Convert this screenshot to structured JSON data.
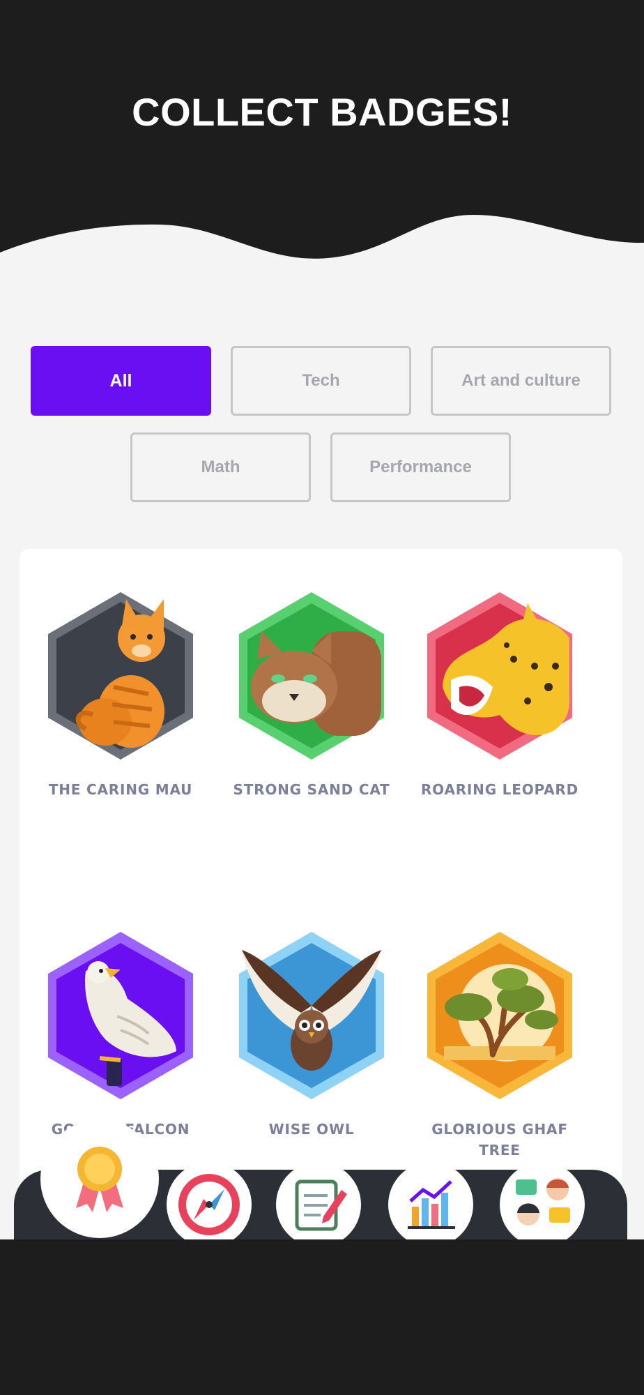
{
  "header": {
    "title": "COLLECT BADGES!"
  },
  "filters": [
    {
      "label": "All",
      "active": true
    },
    {
      "label": "Tech",
      "active": false
    },
    {
      "label": "Art and culture",
      "active": false
    },
    {
      "label": "Math",
      "active": false
    },
    {
      "label": "Performance",
      "active": false
    }
  ],
  "badges": [
    {
      "label": "THE CARING MAU",
      "icon": "cat-icon",
      "color": "#4b4f58"
    },
    {
      "label": "STRONG SAND CAT",
      "icon": "sand-cat-icon",
      "color": "#3fbf5a"
    },
    {
      "label": "ROARING LEOPARD",
      "icon": "leopard-icon",
      "color": "#e8415c"
    },
    {
      "label": "GOLDEN FALCON",
      "icon": "falcon-icon",
      "color": "#8a46ff"
    },
    {
      "label": "WISE OWL",
      "icon": "owl-icon",
      "color": "#5fb5ee"
    },
    {
      "label": "GLORIOUS GHAF TREE",
      "icon": "tree-icon",
      "color": "#f3a423"
    }
  ],
  "nav": [
    {
      "icon": "award-ribbon-icon",
      "active": true
    },
    {
      "icon": "compass-icon",
      "active": false
    },
    {
      "icon": "notepad-pencil-icon",
      "active": false
    },
    {
      "icon": "bar-chart-icon",
      "active": false
    },
    {
      "icon": "chat-people-icon",
      "active": false
    }
  ],
  "colors": {
    "accent": "#6a0ff1",
    "header_bg": "#1d1d1e",
    "nav_bg": "#2c2f35"
  }
}
